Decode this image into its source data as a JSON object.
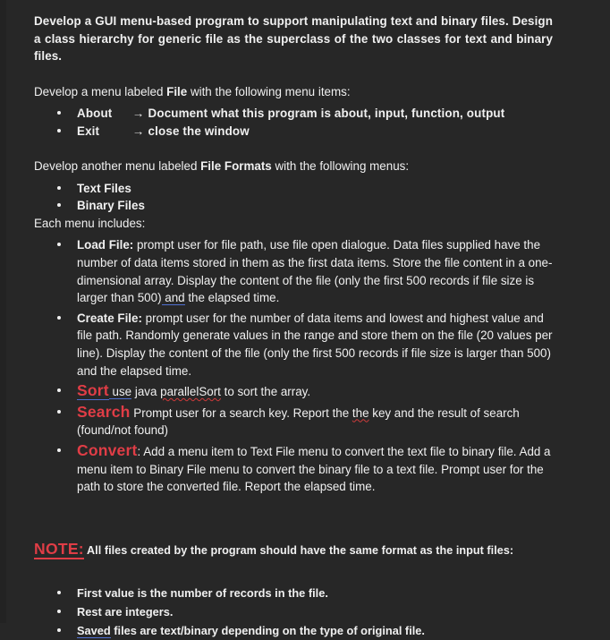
{
  "document": {
    "background_color": "#272727",
    "text_color": "#f0f0f0",
    "accent_red": "#e03d46",
    "spellcheck_blue": "#4f6fd0",
    "spellcheck_red": "#cf3b3b",
    "heading": {
      "text": "Develop a GUI menu-based program to support manipulating text and binary files. Design a class hierarchy for generic file as the superclass of the two classes for text and binary files."
    },
    "section_file_menu": {
      "intro_before": "Develop a menu labeled ",
      "intro_bold": "File",
      "intro_after": " with the following menu items:",
      "items": [
        {
          "name": "About",
          "arrow": "→",
          "description": "Document what this program is about, input, function, output"
        },
        {
          "name": "Exit",
          "arrow": "→",
          "description": "close the window"
        }
      ]
    },
    "section_file_formats": {
      "intro_before": "Develop another menu labeled ",
      "intro_bold": "File Formats",
      "intro_after": " with the following menus:",
      "menus": [
        {
          "label": "Text Files"
        },
        {
          "label": "Binary Files"
        }
      ],
      "each_menu_label": "Each menu includes:",
      "operations": [
        {
          "id": "load-file",
          "label": "Load File:",
          "label_style": "bold-white",
          "body_part_1": " prompt user for file path, use file open dialogue. Data files supplied have the number of data items stored in them as the first data items. Store the file content in a one-dimensional array. Display the content of the file (only the first 500 records if file size is larger than 500)",
          "underlined_blue": " and",
          "body_part_2": " the elapsed time."
        },
        {
          "id": "create-file",
          "label": "Create File:",
          "label_style": "bold-white",
          "body_part_1": " prompt user for the number of data items and lowest and highest value and file path. Randomly generate values in the range and store them on the file (20 values per line). Display the content of the file (only the first 500 records if file size is larger than 500) and the elapsed time."
        },
        {
          "id": "sort",
          "label": "Sort",
          "label_style": "red-large",
          "underlined_blue": " use",
          "body_part_1": " java ",
          "misspelled": "parallelSort",
          "body_part_2": " to sort the array."
        },
        {
          "id": "search",
          "label": "Search",
          "label_style": "red-large",
          "body_part_1": " Prompt user for a search key. Report the ",
          "misspelled": "the",
          "body_part_2": " key and the result of search (found/not found)"
        },
        {
          "id": "convert",
          "label": "Convert",
          "label_style": "red-large",
          "body_part_1": ": Add a menu item to Text File menu to convert the text file to binary file. Add a menu item to Binary File menu to convert the binary file to a text file. Prompt user for the path to store the converted file. Report the elapsed time."
        }
      ]
    },
    "note": {
      "keyword": "NOTE:",
      "text": " All files created by the program should have the same format as the input files:",
      "items": [
        {
          "text": "First value is the number of records in the file."
        },
        {
          "text": "Rest are integers."
        },
        {
          "underlined_blue": "Saved",
          "text": " files are text/binary depending on the type of original file."
        }
      ]
    }
  }
}
